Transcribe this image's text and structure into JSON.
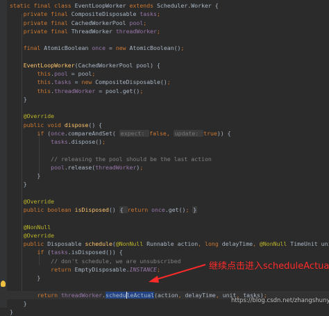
{
  "editor": {
    "lines": [
      [
        {
          "t": "static final class ",
          "c": "kw"
        },
        {
          "t": "EventLoopWorker "
        },
        {
          "t": "extends ",
          "c": "kw"
        },
        {
          "t": "Scheduler.Worker {"
        }
      ],
      [
        {
          "t": "    private final ",
          "c": "kw"
        },
        {
          "t": "CompositeDisposable "
        },
        {
          "t": "tasks",
          "c": "fld"
        },
        {
          "t": ";",
          "c": "kw"
        }
      ],
      [
        {
          "t": "    private final ",
          "c": "kw"
        },
        {
          "t": "CachedWorkerPool "
        },
        {
          "t": "pool",
          "c": "fld"
        },
        {
          "t": ";",
          "c": "kw"
        }
      ],
      [
        {
          "t": "    private final ",
          "c": "kw"
        },
        {
          "t": "ThreadWorker "
        },
        {
          "t": "threadWorker",
          "c": "fld"
        },
        {
          "t": ";",
          "c": "kw"
        }
      ],
      [],
      [
        {
          "t": "    final ",
          "c": "kw"
        },
        {
          "t": "AtomicBoolean "
        },
        {
          "t": "once ",
          "c": "fld"
        },
        {
          "t": "= "
        },
        {
          "t": "new ",
          "c": "kw"
        },
        {
          "t": "AtomicBoolean()"
        },
        {
          "t": ";",
          "c": "kw"
        }
      ],
      [],
      [
        {
          "t": "    "
        },
        {
          "t": "EventLoopWorker",
          "c": "fn"
        },
        {
          "t": "(CachedWorkerPool pool) {"
        }
      ],
      [
        {
          "t": "        "
        },
        {
          "t": "this",
          "c": "kw"
        },
        {
          "t": "."
        },
        {
          "t": "pool ",
          "c": "fld"
        },
        {
          "t": "= pool"
        },
        {
          "t": ";",
          "c": "kw"
        }
      ],
      [
        {
          "t": "        "
        },
        {
          "t": "this",
          "c": "kw"
        },
        {
          "t": "."
        },
        {
          "t": "tasks ",
          "c": "fld"
        },
        {
          "t": "= "
        },
        {
          "t": "new ",
          "c": "kw"
        },
        {
          "t": "CompositeDisposable()"
        },
        {
          "t": ";",
          "c": "kw"
        }
      ],
      [
        {
          "t": "        "
        },
        {
          "t": "this",
          "c": "kw"
        },
        {
          "t": "."
        },
        {
          "t": "threadWorker ",
          "c": "fld"
        },
        {
          "t": "= pool.get()"
        },
        {
          "t": ";",
          "c": "kw"
        }
      ],
      [
        {
          "t": "    }"
        }
      ],
      [],
      [
        {
          "t": "    "
        },
        {
          "t": "@Override",
          "c": "ann"
        }
      ],
      [
        {
          "t": "    "
        },
        {
          "t": "public void ",
          "c": "kw"
        },
        {
          "t": "dispose",
          "c": "fn"
        },
        {
          "t": "() {"
        }
      ],
      [
        {
          "t": "        "
        },
        {
          "t": "if ",
          "c": "kw"
        },
        {
          "t": "("
        },
        {
          "t": "once",
          "c": "fld"
        },
        {
          "t": ".compareAndSet( "
        },
        {
          "t": "expect: ",
          "c": "hint"
        },
        {
          "t": "false",
          "c": "kw"
        },
        {
          "t": ", ",
          "c": "kw"
        },
        {
          "t": "update: ",
          "c": "hint"
        },
        {
          "t": "true",
          "c": "kw"
        },
        {
          "t": ")) {"
        }
      ],
      [
        {
          "t": "            "
        },
        {
          "t": "tasks",
          "c": "fld"
        },
        {
          "t": ".dispose()"
        },
        {
          "t": ";",
          "c": "kw"
        }
      ],
      [],
      [
        {
          "t": "            // releasing the pool should be the last action",
          "c": "cmt"
        }
      ],
      [
        {
          "t": "            "
        },
        {
          "t": "pool",
          "c": "fld"
        },
        {
          "t": ".release("
        },
        {
          "t": "threadWorker",
          "c": "fld"
        },
        {
          "t": ")"
        },
        {
          "t": ";",
          "c": "kw"
        }
      ],
      [
        {
          "t": "        }"
        }
      ],
      [
        {
          "t": "    }"
        }
      ],
      [],
      [
        {
          "t": "    "
        },
        {
          "t": "@Override",
          "c": "ann"
        }
      ],
      [
        {
          "t": "    "
        },
        {
          "t": "public boolean ",
          "c": "kw"
        },
        {
          "t": "isDisposed",
          "c": "fn"
        },
        {
          "t": "() "
        },
        {
          "t": "{ ",
          "c": "fold"
        },
        {
          "t": "return ",
          "c": "kw"
        },
        {
          "t": "once",
          "c": "fld"
        },
        {
          "t": ".get()"
        },
        {
          "t": "; ",
          "c": "kw"
        },
        {
          "t": "}",
          "c": "fold"
        }
      ],
      [],
      [
        {
          "t": "    "
        },
        {
          "t": "@NonNull",
          "c": "ann"
        }
      ],
      [
        {
          "t": "    "
        },
        {
          "t": "@Override",
          "c": "ann"
        }
      ],
      [
        {
          "t": "    "
        },
        {
          "t": "public ",
          "c": "kw"
        },
        {
          "t": "Disposable "
        },
        {
          "t": "schedule",
          "c": "fn"
        },
        {
          "t": "("
        },
        {
          "t": "@NonNull ",
          "c": "ann"
        },
        {
          "t": "Runnable action"
        },
        {
          "t": ", long ",
          "c": "kw"
        },
        {
          "t": "delayTime"
        },
        {
          "t": ", ",
          "c": "kw"
        },
        {
          "t": "@NonNull ",
          "c": "ann"
        },
        {
          "t": "TimeUnit unit) {"
        }
      ],
      [
        {
          "t": "        "
        },
        {
          "t": "if ",
          "c": "kw"
        },
        {
          "t": "("
        },
        {
          "t": "tasks",
          "c": "fld"
        },
        {
          "t": ".isDisposed()) {"
        }
      ],
      [
        {
          "t": "            // don't schedule, we are unsubscribed",
          "c": "cmt"
        }
      ],
      [
        {
          "t": "            "
        },
        {
          "t": "return ",
          "c": "kw"
        },
        {
          "t": "EmptyDisposable."
        },
        {
          "t": "INSTANCE",
          "c": "fld it"
        },
        {
          "t": ";",
          "c": "kw"
        }
      ],
      [
        {
          "t": "        }"
        }
      ],
      [],
      [
        {
          "t": "        "
        },
        {
          "t": "return ",
          "c": "kw"
        },
        {
          "t": "threadWorker",
          "c": "fld"
        },
        {
          "t": "."
        },
        {
          "t": "schedu",
          "c": "sel"
        },
        {
          "t": "",
          "c": "caret"
        },
        {
          "t": "leActual",
          "c": "sel"
        },
        {
          "t": "(action"
        },
        {
          "t": ", ",
          "c": "kw"
        },
        {
          "t": "delayTime"
        },
        {
          "t": ", ",
          "c": "kw"
        },
        {
          "t": "unit"
        },
        {
          "t": ", ",
          "c": "kw"
        },
        {
          "t": "tasks)"
        },
        {
          "t": ";",
          "c": "kw"
        }
      ],
      [
        {
          "t": "    }"
        }
      ],
      [
        {
          "t": "}"
        }
      ]
    ]
  },
  "annotation": {
    "text": "继续点击进入scheduleActual",
    "color": "#ff2a2a"
  },
  "watermark": {
    "text": "https://blog.csdn.net/zhangshuny"
  },
  "icons": {
    "gutter_hint": "lightbulb-icon"
  }
}
